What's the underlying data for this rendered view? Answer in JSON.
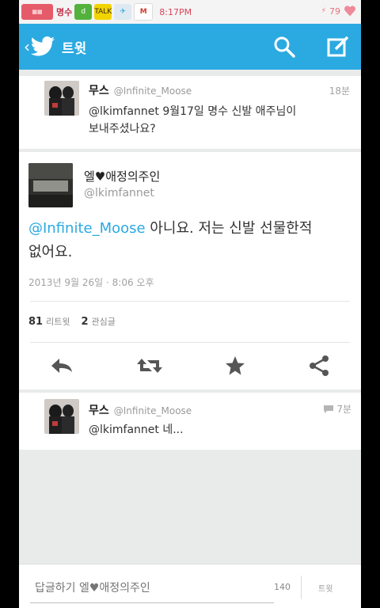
{
  "status_bar": {
    "icon_label": "명수",
    "time": "8:17PM",
    "battery": "79"
  },
  "app_bar": {
    "title": "트윗"
  },
  "tweets": {
    "parent": {
      "name": "무스",
      "handle": "@Infinite_Moose",
      "time": "18분",
      "text_line1": "@lkimfannet 9월17일 명수 신발 애주님이",
      "text_line2": "보내주셨나요?"
    },
    "main": {
      "name": "엘♥애정의주인",
      "handle": "@lkimfannet",
      "mention": "@Infinite_Moose",
      "text_line1_rest": " 아니요. 저는 신발 선물한적",
      "text_line2": "없어요.",
      "date": "2013년 9월 26일 · 8:06 오후",
      "retweets_count": "81",
      "retweets_label": "리트윗",
      "favorites_count": "2",
      "favorites_label": "관심글"
    },
    "reply": {
      "name": "무스",
      "handle": "@Infinite_Moose",
      "time": "7분",
      "text": "@lkimfannet 네..."
    }
  },
  "reply_bar": {
    "placeholder": "답글하기 엘♥애정의주인",
    "char_count": "140",
    "tweet_label": "트윗"
  },
  "colors": {
    "accent": "#2ba9e1"
  }
}
